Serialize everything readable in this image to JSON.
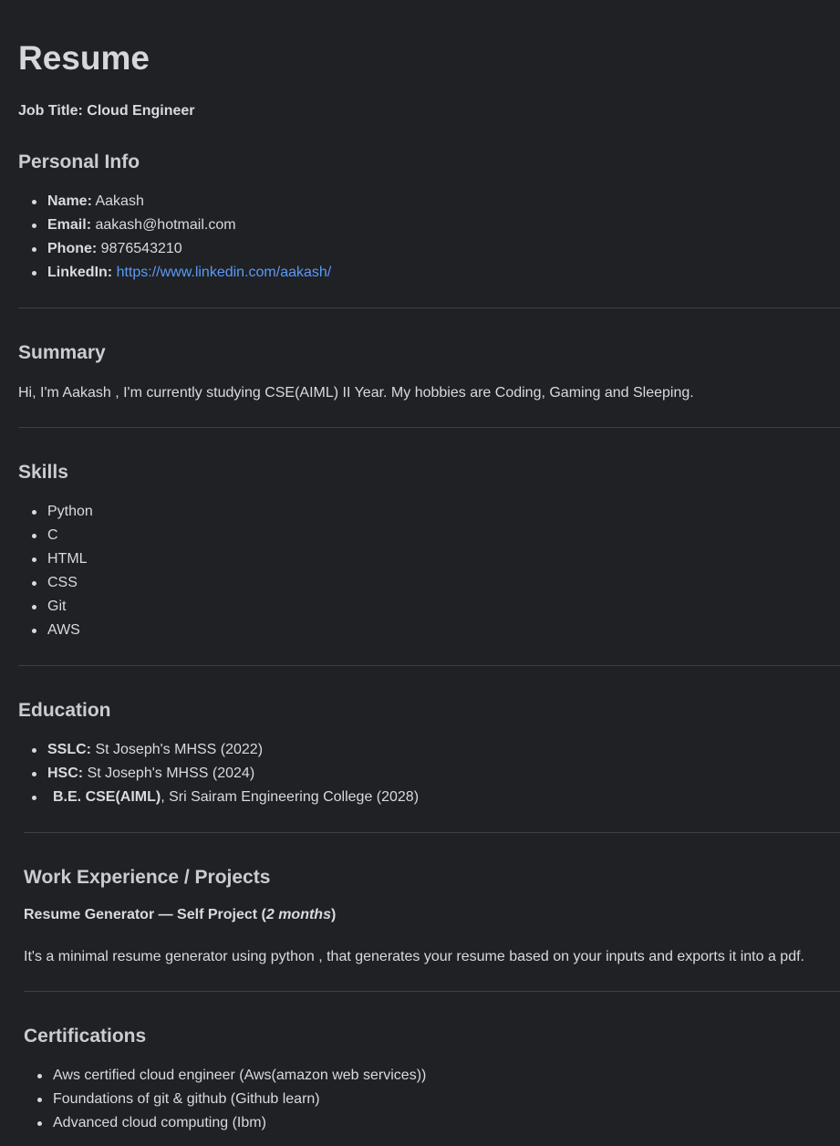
{
  "title": "Resume",
  "job_title": "Job Title: Cloud Engineer",
  "personal_info": {
    "heading": "Personal Info",
    "name_label": "Name:",
    "name_value": "Aakash",
    "email_label": "Email:",
    "email_value": "aakash@hotmail.com",
    "phone_label": "Phone:",
    "phone_value": "9876543210",
    "linkedin_label": "LinkedIn:",
    "linkedin_value": "https://www.linkedin.com/aakash/"
  },
  "summary": {
    "heading": "Summary",
    "text": "Hi, I'm Aakash , I'm currently studying CSE(AIML) II Year. My hobbies are Coding, Gaming and Sleeping."
  },
  "skills": {
    "heading": "Skills",
    "items": [
      "Python",
      "C",
      "HTML",
      "CSS",
      "Git",
      "AWS"
    ]
  },
  "education": {
    "heading": "Education",
    "items": [
      {
        "label": "SSLC:",
        "value": "St Joseph's MHSS (2022)"
      },
      {
        "label": "HSC:",
        "value": "St Joseph's MHSS (2024)"
      },
      {
        "label": "B.E. CSE(AIML)",
        "value": ", Sri Sairam Engineering College (2028)"
      }
    ]
  },
  "work": {
    "heading": "Work Experience / Projects",
    "project_title": "Resume Generator — Self Project (",
    "project_duration": "2 months",
    "project_close": ")",
    "project_desc": "It's a minimal resume generator using python , that generates your resume based on your inputs and exports it into a pdf."
  },
  "certifications": {
    "heading": "Certifications",
    "items": [
      "Aws certified cloud engineer (Aws(amazon web services))",
      "Foundations of git & github (Github learn)",
      "Advanced cloud computing (Ibm)"
    ]
  }
}
